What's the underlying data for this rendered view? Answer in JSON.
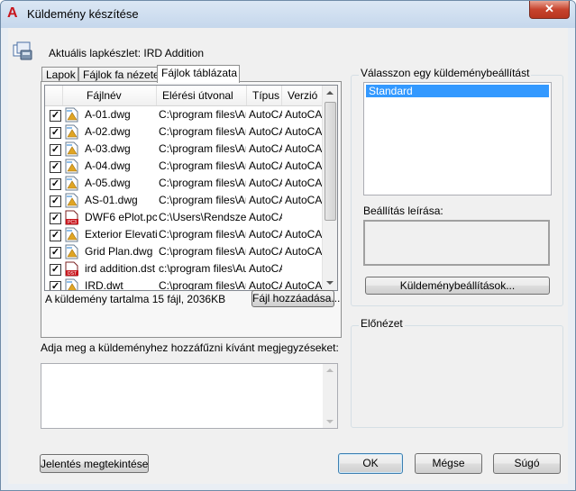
{
  "window": {
    "title": "Küldemény készítése",
    "close_label": "✕"
  },
  "header": {
    "current_sheetset_label": "Aktuális lapkészlet: IRD Addition"
  },
  "tabs": [
    {
      "label": "Lapok"
    },
    {
      "label": "Fájlok fa nézete"
    },
    {
      "label": "Fájlok táblázata"
    }
  ],
  "table": {
    "columns": [
      "Fájlnév",
      "Elérési útvonal",
      "Típus",
      "Verzió"
    ],
    "rows": [
      {
        "name": "A-01.dwg",
        "path": "C:\\program files\\Aut",
        "type": "AutoCA",
        "version": "AutoCAD",
        "checked": true,
        "icon": "dwg-file-icon"
      },
      {
        "name": "A-02.dwg",
        "path": "C:\\program files\\Aut",
        "type": "AutoCA",
        "version": "AutoCAD",
        "checked": true,
        "icon": "dwg-file-icon"
      },
      {
        "name": "A-03.dwg",
        "path": "C:\\program files\\Aut",
        "type": "AutoCA",
        "version": "AutoCAD",
        "checked": true,
        "icon": "dwg-file-icon"
      },
      {
        "name": "A-04.dwg",
        "path": "C:\\program files\\Aut",
        "type": "AutoCA",
        "version": "AutoCAD",
        "checked": true,
        "icon": "dwg-file-icon"
      },
      {
        "name": "A-05.dwg",
        "path": "C:\\program files\\Aut",
        "type": "AutoCA",
        "version": "AutoCAD",
        "checked": true,
        "icon": "dwg-file-icon"
      },
      {
        "name": "AS-01.dwg",
        "path": "C:\\program files\\Aut",
        "type": "AutoCA",
        "version": "AutoCAD",
        "checked": true,
        "icon": "dwg-file-icon"
      },
      {
        "name": "DWF6 ePlot.pc3",
        "path": "C:\\Users\\Rendszerg",
        "type": "AutoCA",
        "version": "",
        "checked": true,
        "icon": "pc3-file-icon"
      },
      {
        "name": "Exterior Elevatio",
        "path": "C:\\program files\\Aut",
        "type": "AutoCA",
        "version": "AutoCAD",
        "checked": true,
        "icon": "dwg-file-icon"
      },
      {
        "name": "Grid Plan.dwg",
        "path": "C:\\program files\\Aut",
        "type": "AutoCA",
        "version": "AutoCAD",
        "checked": true,
        "icon": "dwg-file-icon"
      },
      {
        "name": "ird addition.dst",
        "path": "c:\\program files\\Aut",
        "type": "AutoCA",
        "version": "",
        "checked": true,
        "icon": "dst-file-icon"
      },
      {
        "name": "IRD.dwt",
        "path": "C:\\program files\\Aut",
        "type": "AutoCA",
        "version": "AutoCAD",
        "checked": true,
        "icon": "dwg-file-icon"
      }
    ]
  },
  "summary": {
    "contents_label": "A küldemény tartalma 15 fájl, 2036KB",
    "add_file_button": "Fájl hozzáadása..."
  },
  "notes": {
    "label": "Adja meg a küldeményhez hozzáfűzni kívánt megjegyzéseket:",
    "value": ""
  },
  "setup": {
    "select_label": "Válasszon egy küldeménybeállítást",
    "options": [
      "Standard"
    ],
    "selected": "Standard",
    "description_label": "Beállítás leírása:",
    "description_value": "",
    "setups_button": "Küldeménybeállítások..."
  },
  "preview": {
    "label": "Előnézet"
  },
  "footer": {
    "view_report_button": "Jelentés megtekintése",
    "ok_button": "OK",
    "cancel_button": "Mégse",
    "help_button": "Súgó"
  },
  "colors": {
    "accent": "#3399ff",
    "close_red": "#c7432d",
    "brand": "#c8161d"
  }
}
